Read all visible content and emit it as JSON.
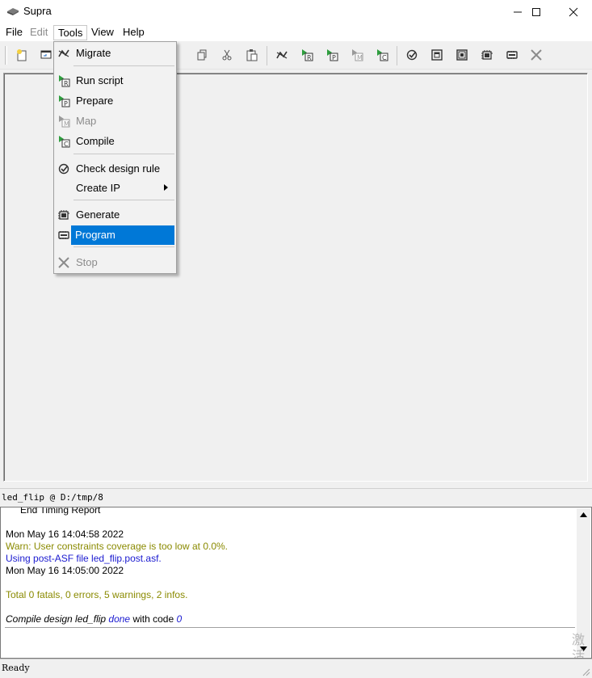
{
  "window": {
    "title": "Supra",
    "minimize_glyph": "—",
    "maximize_glyph": "☐",
    "close_glyph": "✕"
  },
  "menubar": {
    "items": [
      "File",
      "Edit",
      "Tools",
      "View",
      "Help"
    ]
  },
  "toolbar": {
    "icons": [
      "new-file-icon",
      "open-file-icon",
      "copy-icon",
      "cut-icon",
      "paste-icon",
      "migrate-icon",
      "run-script-icon",
      "prepare-icon",
      "map-icon",
      "compile-icon",
      "check-design-rule-icon",
      "report-icon",
      "report-alt-icon",
      "generate-icon",
      "program-icon",
      "stop-icon"
    ]
  },
  "tools_menu": {
    "items": [
      {
        "label": "Migrate",
        "icon": "migrate-icon",
        "enabled": true
      },
      {
        "label": "Run script",
        "icon": "run-script-icon",
        "enabled": true
      },
      {
        "label": "Prepare",
        "icon": "prepare-icon",
        "enabled": true
      },
      {
        "label": "Map",
        "icon": "map-icon",
        "enabled": false
      },
      {
        "label": "Compile",
        "icon": "compile-icon",
        "enabled": true
      },
      {
        "label": "Check design rule",
        "icon": "check-design-rule-icon",
        "enabled": true
      },
      {
        "label": "Create IP",
        "icon": "",
        "enabled": true,
        "submenu": true
      },
      {
        "label": "Generate",
        "icon": "generate-icon",
        "enabled": true
      },
      {
        "label": "Program",
        "icon": "program-icon",
        "enabled": true,
        "selected": true
      },
      {
        "label": "Stop",
        "icon": "stop-icon",
        "enabled": false
      }
    ]
  },
  "project": {
    "label": "led_flip @ D:/tmp/8"
  },
  "log": {
    "partial_line": "End Timing Report",
    "lines": [
      "Mon May 16 14:04:58 2022",
      "Warn: User constraints coverage is too low at 0.0%.",
      "Using post-ASF file led_flip.post.asf.",
      "Mon May 16 14:05:00 2022",
      "Total 0 fatals, 0 errors, 5 warnings, 2 infos."
    ],
    "compile_prefix": "Compile design led_flip ",
    "compile_done": "done",
    "compile_mid": " with code ",
    "compile_code": "0",
    "watermark": "激活 转到"
  },
  "status": {
    "text": "Ready"
  },
  "colors": {
    "warn": "#8a8a00",
    "info": "#1a1ad0",
    "selection": "#0078d7"
  }
}
